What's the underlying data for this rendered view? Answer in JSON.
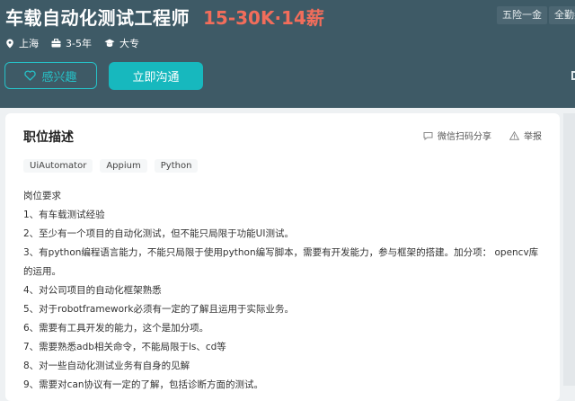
{
  "job": {
    "title": "车载自动化测试工程师",
    "salary": "15-30K·14薪",
    "welfare": [
      "五险一金",
      "全勤奖"
    ],
    "meta": {
      "location": "上海",
      "experience": "3-5年",
      "education": "大专"
    }
  },
  "buttons": {
    "interest_label": "感兴趣",
    "chat_label": "立即沟通"
  },
  "detail": {
    "section_title": "职位描述",
    "share_label": "微信扫码分享",
    "report_label": "举报",
    "tags": [
      "UiAutomator",
      "Appium",
      "Python"
    ],
    "description": [
      "岗位要求",
      "1、有车载测试经验",
      "2、至少有一个项目的自动化测试，但不能只局限于功能UI测试。",
      "3、有python编程语言能力，不能只局限于使用python编写脚本，需要有开发能力，参与框架的搭建。加分项： opencv库的运用。",
      "4、对公司项目的自动化框架熟悉",
      "5、对于robotframework必须有一定的了解且运用于实际业务。",
      "6、需要有工具开发的能力，这个是加分项。",
      "7、需要熟悉adb相关命令，不能局限于ls、cd等",
      "8、对一些自动化测试业务有自身的见解",
      "9、需要对can协议有一定的了解，包括诊断方面的测试。"
    ]
  },
  "colors": {
    "header_bg": "#3e5a66",
    "salary": "#f26d5b",
    "accent": "#17b8be"
  }
}
